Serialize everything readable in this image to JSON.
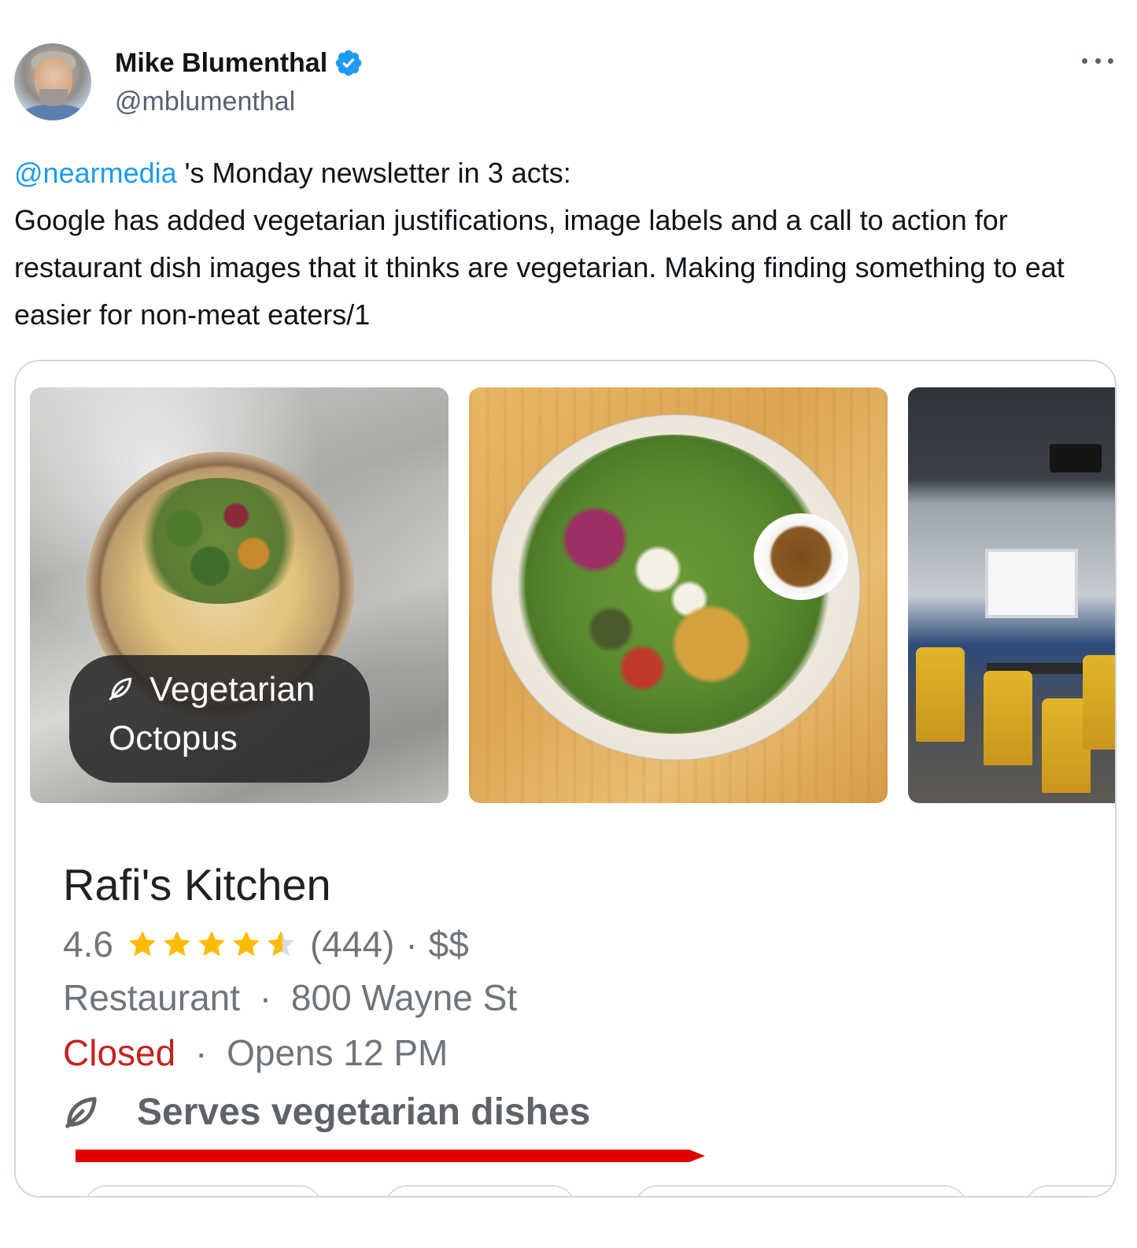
{
  "author": {
    "name": "Mike Blumenthal",
    "handle": "@mblumenthal"
  },
  "tweet": {
    "mention": "@nearmedia",
    "line1_rest": " 's Monday newsletter in 3 acts:",
    "body": "Google has added vegetarian justifications, image labels and a call to action for restaurant dish images that it thinks are vegetarian. Making finding something to eat easier for non-meat eaters/1"
  },
  "card": {
    "badge_line1": "Vegetarian",
    "badge_line2": "Octopus",
    "place_name": "Rafi's Kitchen",
    "rating": "4.6",
    "rating_value": 4.6,
    "reviews": "(444)",
    "separator": "·",
    "price": "$$",
    "category": "Restaurant",
    "address": "800 Wayne St",
    "status_closed": "Closed",
    "opens": "Opens 12 PM",
    "veg_label": "Serves vegetarian dishes"
  },
  "icons": {
    "verified": "verified-badge-icon",
    "more": "more-options-icon",
    "leaf": "leaf-icon",
    "star": "star-icon"
  },
  "colors": {
    "link": "#1d9bf0",
    "verified": "#1d9bf0",
    "closed": "#c5221f",
    "star": "#fbbc04",
    "annotation_arrow": "#e00000"
  }
}
